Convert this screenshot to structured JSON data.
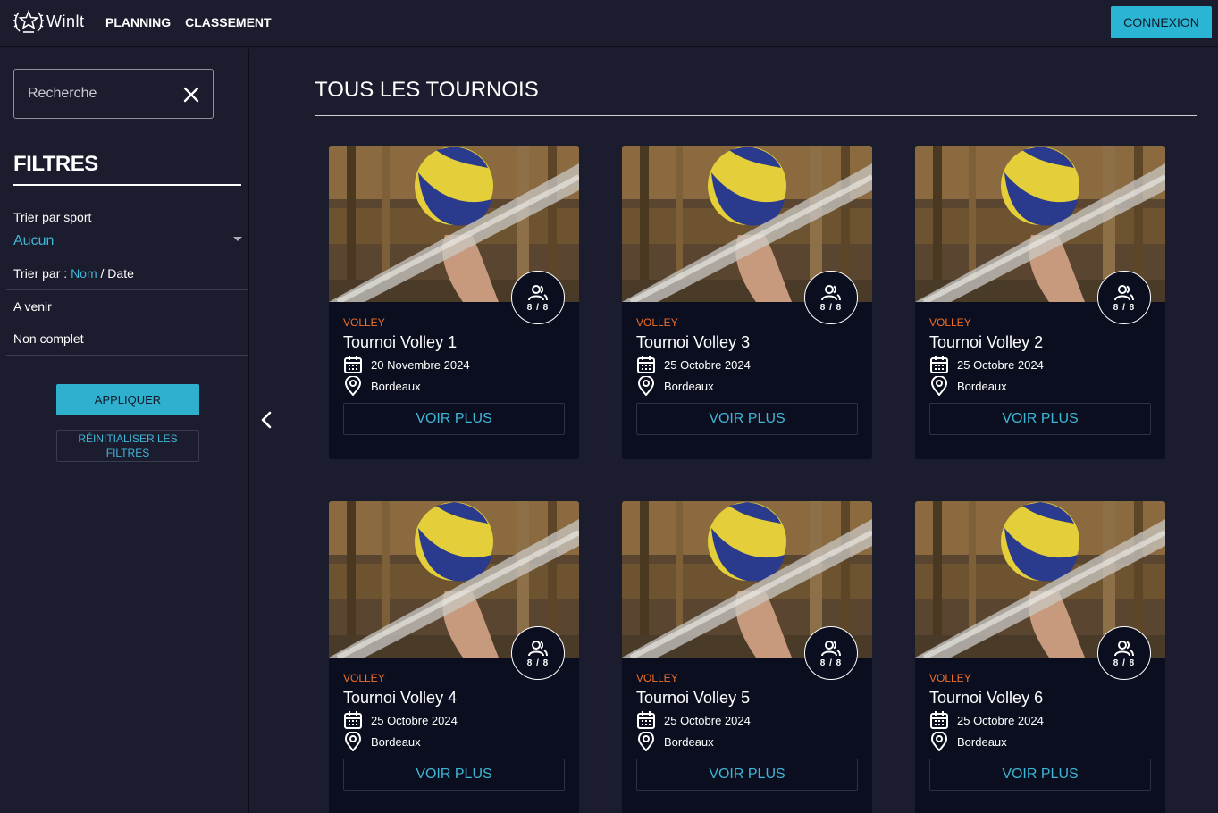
{
  "header": {
    "brand": "Winlt",
    "nav": [
      "PLANNING",
      "CLASSEMENT"
    ],
    "login_label": "CONNEXION"
  },
  "sidebar": {
    "search_placeholder": "Recherche",
    "filters_title": "FILTRES",
    "sort_sport_label": "Trier par sport",
    "sport_value": "Aucun",
    "sort_by_label": "Trier par",
    "sort_by_colon": " : ",
    "sort_opt_name": "Nom",
    "sort_sep": " / ",
    "sort_opt_date": "Date",
    "filter_upcoming": "A venir",
    "filter_incomplete": "Non complet",
    "apply_label": "APPLIQUER",
    "reset_label": "RÉINITIALISER LES FILTRES"
  },
  "main": {
    "title": "TOUS LES TOURNOIS",
    "cards": [
      {
        "sport": "VOLLEY",
        "name": "Tournoi Volley 1",
        "date": "20 Novembre 2024",
        "place": "Bordeaux",
        "count": "8 / 8",
        "button": "VOIR PLUS"
      },
      {
        "sport": "VOLLEY",
        "name": "Tournoi Volley 3",
        "date": "25 Octobre 2024",
        "place": "Bordeaux",
        "count": "8 / 8",
        "button": "VOIR PLUS"
      },
      {
        "sport": "VOLLEY",
        "name": "Tournoi Volley 2",
        "date": "25 Octobre 2024",
        "place": "Bordeaux",
        "count": "8 / 8",
        "button": "VOIR PLUS"
      },
      {
        "sport": "VOLLEY",
        "name": "Tournoi Volley 4",
        "date": "25 Octobre 2024",
        "place": "Bordeaux",
        "count": "8 / 8",
        "button": "VOIR PLUS"
      },
      {
        "sport": "VOLLEY",
        "name": "Tournoi Volley 5",
        "date": "25 Octobre 2024",
        "place": "Bordeaux",
        "count": "8 / 8",
        "button": "VOIR PLUS"
      },
      {
        "sport": "VOLLEY",
        "name": "Tournoi Volley 6",
        "date": "25 Octobre 2024",
        "place": "Bordeaux",
        "count": "8 / 8",
        "button": "VOIR PLUS"
      }
    ]
  },
  "colors": {
    "accent": "#2bb5d4",
    "sport": "#f06f28",
    "background": "#1b1c2e",
    "card": "#0b0e1f"
  },
  "icons": [
    "laurel-star-logo-icon",
    "close-icon",
    "chevron-left-icon",
    "users-icon",
    "calendar-icon",
    "location-pin-icon"
  ]
}
